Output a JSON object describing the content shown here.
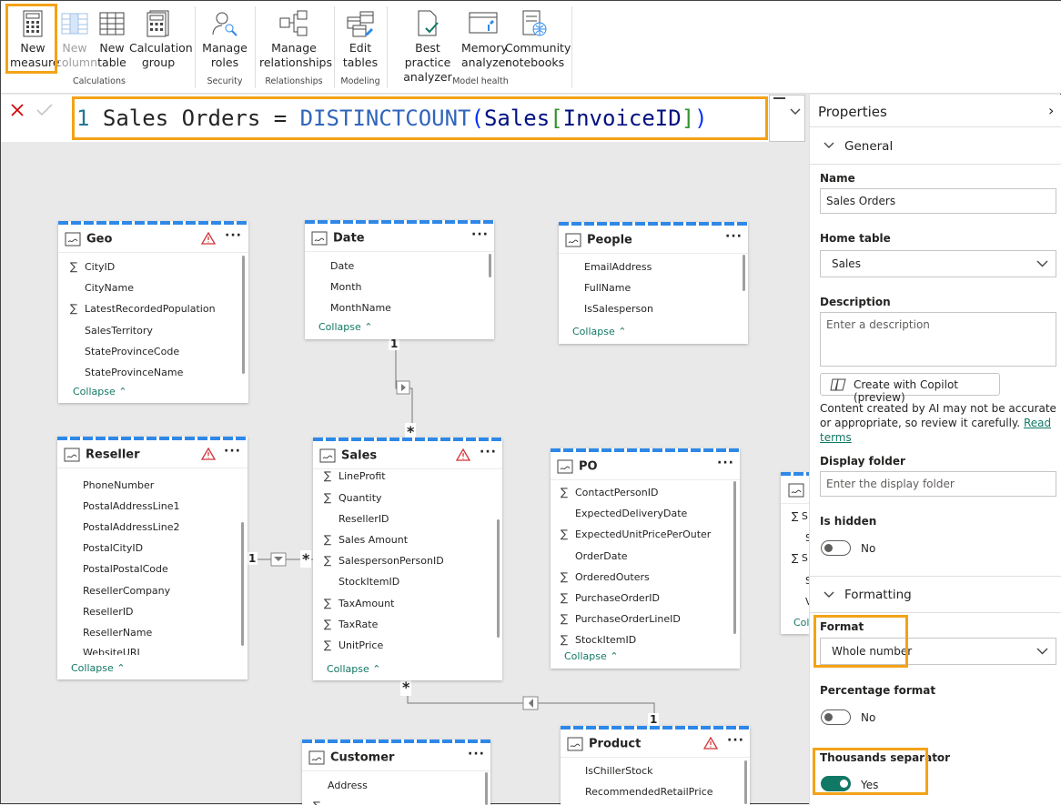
{
  "ribbon": {
    "new_measure": "New measure",
    "new_column": "New column",
    "new_table": "New table",
    "calculation_group": "Calculation group",
    "manage_roles": "Manage roles",
    "manage_relationships": "Manage relationships",
    "edit_tables": "Edit tables",
    "best_practice": "Best practice analyzer",
    "memory_analyzer": "Memory analyzer",
    "community_notebooks": "Community notebooks",
    "groups": {
      "calculations": "Calculations",
      "security": "Security",
      "relationships": "Relationships",
      "modeling": "Modeling",
      "model_health": "Model health"
    }
  },
  "formula": {
    "line": "1",
    "name": "Sales Orders",
    "eq": "=",
    "func": "DISTINCTCOUNT",
    "open": "(",
    "table": "Sales",
    "lb": "[",
    "col": "InvoiceID",
    "rb": "]",
    "close": ")"
  },
  "properties": {
    "title": "Properties",
    "general": "General",
    "name_label": "Name",
    "name_value": "Sales Orders",
    "home_table_label": "Home table",
    "home_table_value": "Sales",
    "description_label": "Description",
    "description_placeholder": "Enter a description",
    "copilot_button": "Create with Copilot (preview)",
    "ai_note": "Content created by AI may not be accurate or appropriate, so review it carefully.",
    "read_terms": "Read terms",
    "display_folder_label": "Display folder",
    "display_folder_placeholder": "Enter the display folder",
    "is_hidden_label": "Is hidden",
    "is_hidden_value": "No",
    "formatting": "Formatting",
    "format_label": "Format",
    "format_value": "Whole number",
    "percentage_label": "Percentage format",
    "percentage_value": "No",
    "thousands_label": "Thousands separator",
    "thousands_value": "Yes"
  },
  "tables": {
    "geo": {
      "title": "Geo",
      "fields": [
        "CityID",
        "CityName",
        "LatestRecordedPopulation",
        "SalesTerritory",
        "StateProvinceCode",
        "StateProvinceName"
      ]
    },
    "date": {
      "title": "Date",
      "fields": [
        "Date",
        "Month",
        "MonthName"
      ]
    },
    "people": {
      "title": "People",
      "fields": [
        "EmailAddress",
        "FullName",
        "IsSalesperson"
      ]
    },
    "reseller": {
      "title": "Reseller",
      "fields": [
        "PhoneNumber",
        "PostalAddressLine1",
        "PostalAddressLine2",
        "PostalCityID",
        "PostalPostalCode",
        "ResellerCompany",
        "ResellerID",
        "ResellerName",
        "WebsiteURL"
      ]
    },
    "sales": {
      "title": "Sales",
      "fields": [
        "LineProfit",
        "Quantity",
        "ResellerID",
        "Sales Amount",
        "SalespersonPersonID",
        "StockItemID",
        "TaxAmount",
        "TaxRate",
        "UnitPrice"
      ]
    },
    "po": {
      "title": "PO",
      "fields": [
        "ContactPersonID",
        "ExpectedDeliveryDate",
        "ExpectedUnitPricePerOuter",
        "OrderDate",
        "OrderedOuters",
        "PurchaseOrderID",
        "PurchaseOrderLineID",
        "StockItemID"
      ]
    },
    "customer": {
      "title": "Customer",
      "fields": [
        "Address"
      ]
    },
    "product": {
      "title": "Product",
      "fields": [
        "IsChillerStock",
        "RecommendedRetailPrice"
      ]
    },
    "collapse": "Collapse",
    "partial_collapse": "Col"
  },
  "relations": {
    "one": "1",
    "many": "*"
  }
}
